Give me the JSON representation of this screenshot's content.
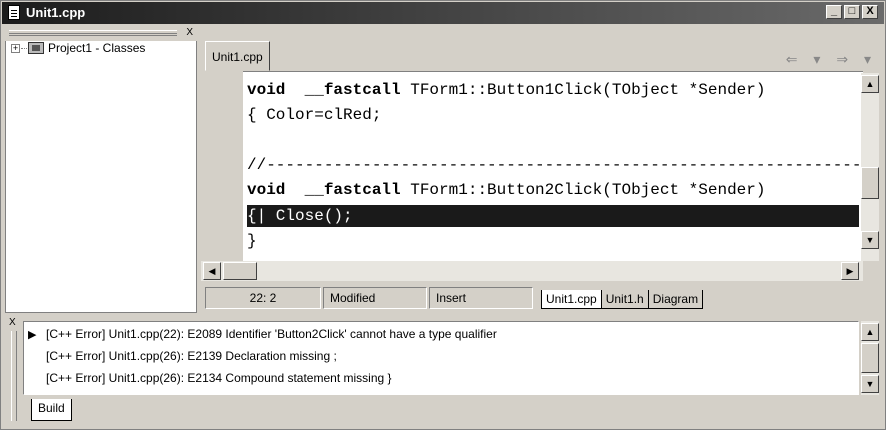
{
  "window": {
    "title": "Unit1.cpp",
    "controls": {
      "minimize": "_",
      "maximize": "□",
      "close": "X"
    }
  },
  "class_explorer": {
    "close": "X",
    "expander": "+",
    "root_label": "Project1 - Classes"
  },
  "editor": {
    "tab_label": "Unit1.cpp",
    "nav": {
      "back": "⇐ ▾",
      "forward": "⇒ ▾"
    },
    "lines": [
      {
        "kw": "void  __fastcall",
        "rest": " TForm1::Button1Click(TObject *Sender)"
      },
      {
        "kw": "",
        "rest": "{ Color=clRed;"
      },
      {
        "kw": "",
        "rest": ""
      },
      {
        "kw": "",
        "rest": "//------------------------------------------------------------------"
      },
      {
        "kw": "void  __fastcall",
        "rest": " TForm1::Button2Click(TObject *Sender)"
      },
      {
        "kw": "",
        "rest": "{| Close();"
      },
      {
        "kw": "",
        "rest": "}"
      }
    ]
  },
  "status": {
    "position": "22:  2",
    "modified": "Modified",
    "mode": "Insert",
    "file_tabs": [
      "Unit1.cpp",
      "Unit1.h",
      "Diagram"
    ]
  },
  "messages": {
    "close": "X",
    "items": [
      "[C++ Error] Unit1.cpp(22): E2089 Identifier 'Button2Click' cannot have a type qualifier",
      "[C++ Error] Unit1.cpp(26): E2139 Declaration missing ;",
      "[C++ Error] Unit1.cpp(26): E2134 Compound statement missing }"
    ],
    "tab_label": "Build"
  }
}
